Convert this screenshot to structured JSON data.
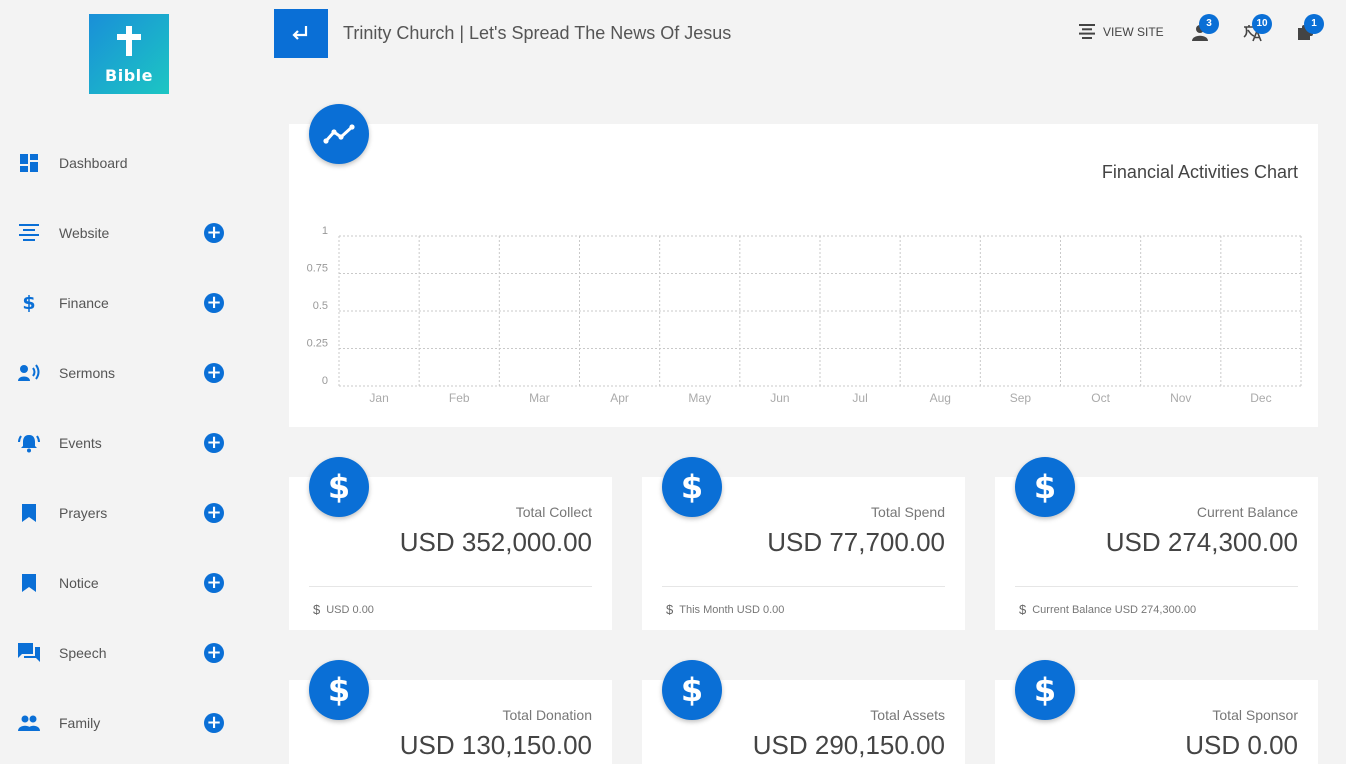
{
  "logo": {
    "text": "Bible"
  },
  "header": {
    "title": "Trinity Church | Let's Spread The News Of Jesus",
    "view_site": "VIEW SITE",
    "badges": {
      "users": "3",
      "translate": "10",
      "plugins": "1"
    }
  },
  "sidebar": {
    "items": [
      {
        "label": "Dashboard",
        "icon": "dashboard-icon"
      },
      {
        "label": "Website",
        "icon": "align-center-icon"
      },
      {
        "label": "Finance",
        "icon": "dollar-icon"
      },
      {
        "label": "Sermons",
        "icon": "speaker-icon"
      },
      {
        "label": "Events",
        "icon": "bell-icon"
      },
      {
        "label": "Prayers",
        "icon": "bookmark-icon"
      },
      {
        "label": "Notice",
        "icon": "bookmark-icon"
      },
      {
        "label": "Speech",
        "icon": "chat-icon"
      },
      {
        "label": "Family",
        "icon": "people-icon"
      }
    ]
  },
  "chart": {
    "title": "Financial Activities Chart"
  },
  "chart_data": {
    "type": "line",
    "title": "Financial Activities Chart",
    "categories": [
      "Jan",
      "Feb",
      "Mar",
      "Apr",
      "May",
      "Jun",
      "Jul",
      "Aug",
      "Sep",
      "Oct",
      "Nov",
      "Dec"
    ],
    "yticks": [
      "0",
      "0.25",
      "0.5",
      "0.75",
      "1"
    ],
    "ylim": [
      0,
      1
    ],
    "series": [],
    "grid": true
  },
  "stats": [
    {
      "label": "Total Collect",
      "value": "USD 352,000.00",
      "footer": "USD 0.00"
    },
    {
      "label": "Total Spend",
      "value": "USD 77,700.00",
      "footer": "This Month USD 0.00"
    },
    {
      "label": "Current Balance",
      "value": "USD 274,300.00",
      "footer": "Current Balance USD 274,300.00"
    },
    {
      "label": "Total Donation",
      "value": "USD 130,150.00",
      "footer": ""
    },
    {
      "label": "Total Assets",
      "value": "USD 290,150.00",
      "footer": ""
    },
    {
      "label": "Total Sponsor",
      "value": "USD 0.00",
      "footer": ""
    }
  ],
  "colors": {
    "accent": "#0a6fd6",
    "logo_start": "#1a8fd8",
    "logo_end": "#1cc6c3",
    "background": "#f3f3f3"
  }
}
